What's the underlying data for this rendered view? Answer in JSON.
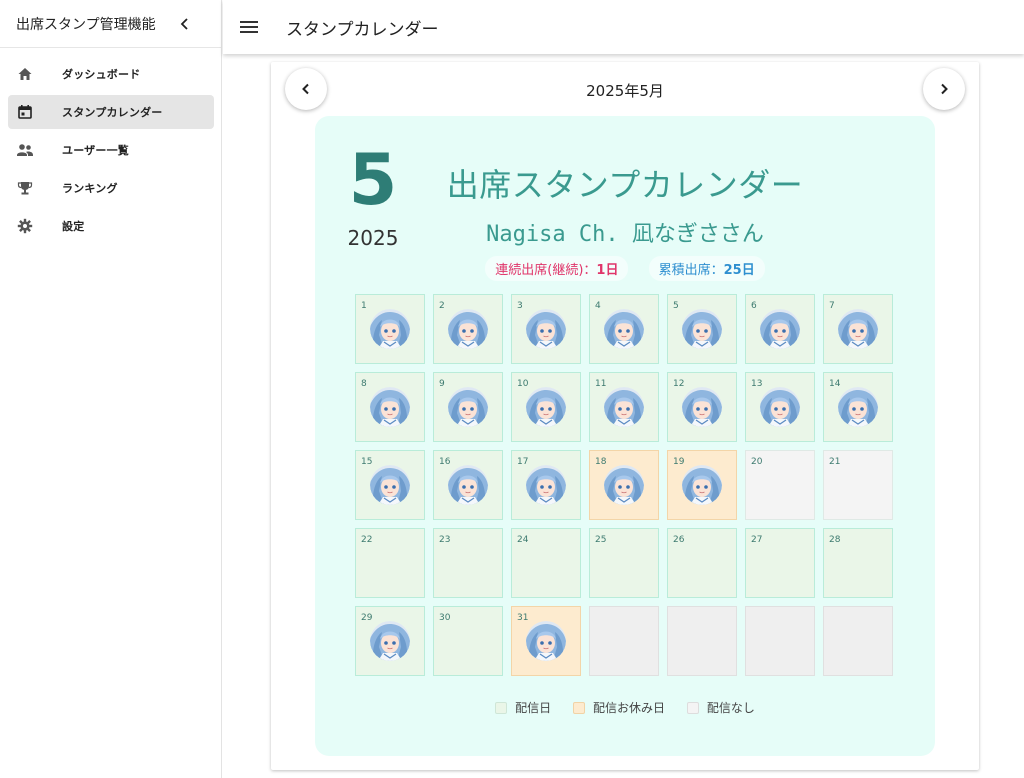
{
  "app": {
    "sidebar_title": "出席スタンプ管理機能",
    "page_title": "スタンプカレンダー"
  },
  "sidebar": {
    "items": [
      {
        "label": "ダッシュボード",
        "icon": "home-icon",
        "active": false
      },
      {
        "label": "スタンプカレンダー",
        "icon": "calendar-icon",
        "active": true
      },
      {
        "label": "ユーザー一覧",
        "icon": "users-icon",
        "active": false
      },
      {
        "label": "ランキング",
        "icon": "trophy-icon",
        "active": false
      },
      {
        "label": "設定",
        "icon": "gear-icon",
        "active": false
      }
    ]
  },
  "calendar": {
    "month_label": "2025年5月",
    "big_month": "5",
    "big_year": "2025",
    "title": "出席スタンプカレンダー",
    "streamer": "Nagisa Ch. 凪なぎささん",
    "consecutive_label": "連続出席(継続)：",
    "consecutive_value": "1日",
    "total_label": "累積出席：",
    "total_value": "25日",
    "days": [
      {
        "d": "1",
        "type": "stream",
        "stamp": true
      },
      {
        "d": "2",
        "type": "stream",
        "stamp": true
      },
      {
        "d": "3",
        "type": "stream",
        "stamp": true
      },
      {
        "d": "4",
        "type": "stream",
        "stamp": true
      },
      {
        "d": "5",
        "type": "stream",
        "stamp": true
      },
      {
        "d": "6",
        "type": "stream",
        "stamp": true
      },
      {
        "d": "7",
        "type": "stream",
        "stamp": true
      },
      {
        "d": "8",
        "type": "stream",
        "stamp": true
      },
      {
        "d": "9",
        "type": "stream",
        "stamp": true
      },
      {
        "d": "10",
        "type": "stream",
        "stamp": true
      },
      {
        "d": "11",
        "type": "stream",
        "stamp": true
      },
      {
        "d": "12",
        "type": "stream",
        "stamp": true
      },
      {
        "d": "13",
        "type": "stream",
        "stamp": true
      },
      {
        "d": "14",
        "type": "stream",
        "stamp": true
      },
      {
        "d": "15",
        "type": "stream",
        "stamp": true
      },
      {
        "d": "16",
        "type": "stream",
        "stamp": true
      },
      {
        "d": "17",
        "type": "stream",
        "stamp": true
      },
      {
        "d": "18",
        "type": "rest",
        "stamp": true
      },
      {
        "d": "19",
        "type": "rest",
        "stamp": true
      },
      {
        "d": "20",
        "type": "none",
        "stamp": false
      },
      {
        "d": "21",
        "type": "none",
        "stamp": false
      },
      {
        "d": "22",
        "type": "stream",
        "stamp": false
      },
      {
        "d": "23",
        "type": "stream",
        "stamp": false
      },
      {
        "d": "24",
        "type": "stream",
        "stamp": false
      },
      {
        "d": "25",
        "type": "stream",
        "stamp": false
      },
      {
        "d": "26",
        "type": "stream",
        "stamp": false
      },
      {
        "d": "27",
        "type": "stream",
        "stamp": false
      },
      {
        "d": "28",
        "type": "stream",
        "stamp": false
      },
      {
        "d": "29",
        "type": "stream",
        "stamp": true
      },
      {
        "d": "30",
        "type": "stream",
        "stamp": false
      },
      {
        "d": "31",
        "type": "rest",
        "stamp": true
      },
      {
        "d": "",
        "type": "blank",
        "stamp": false
      },
      {
        "d": "",
        "type": "blank",
        "stamp": false
      },
      {
        "d": "",
        "type": "blank",
        "stamp": false
      },
      {
        "d": "",
        "type": "blank",
        "stamp": false
      }
    ],
    "legend": [
      {
        "label": "配信日",
        "color": "#eaf6e8"
      },
      {
        "label": "配信お休み日",
        "color": "#fdebcf"
      },
      {
        "label": "配信なし",
        "color": "#f4f4f4"
      }
    ]
  }
}
